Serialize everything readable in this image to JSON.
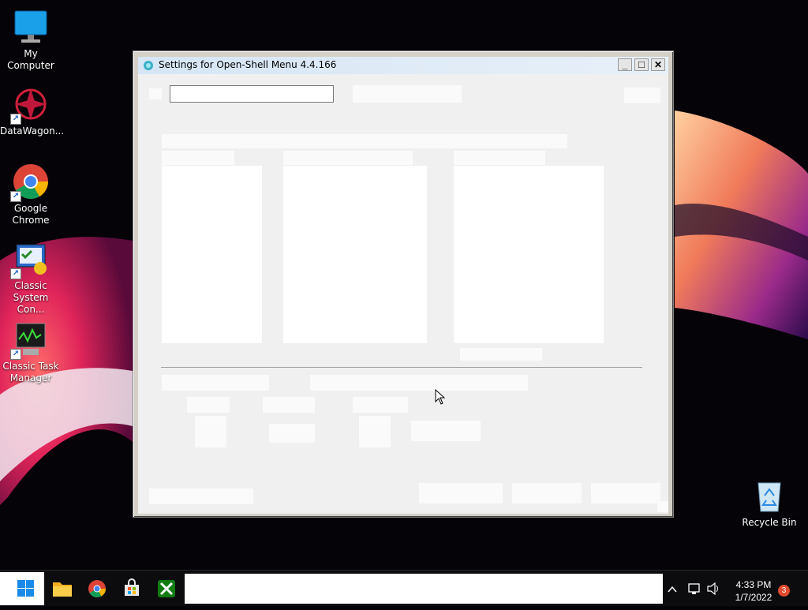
{
  "desktop": {
    "icons": [
      {
        "label": "My Computer",
        "icon": "monitor-icon"
      },
      {
        "label": "DataWagon...",
        "icon": "datawagon-icon"
      },
      {
        "label": "Google Chrome",
        "icon": "chrome-icon"
      },
      {
        "label": "Classic System Con...",
        "icon": "control-panel-icon"
      },
      {
        "label": "Classic Task Manager",
        "icon": "task-manager-icon"
      },
      {
        "label": "Recycle Bin",
        "icon": "recycle-bin-icon"
      }
    ]
  },
  "window": {
    "title": "Settings for Open-Shell Menu 4.4.166",
    "search_value": "",
    "controls": {
      "minimize": "_",
      "maximize": "□",
      "close": "✕"
    }
  },
  "taskbar": {
    "pinned": [
      "start-icon",
      "file-explorer-icon",
      "chrome-icon",
      "store-icon",
      "xbox-icon"
    ],
    "time": "4:33 PM",
    "date": "1/7/2022",
    "notification_count": "3"
  },
  "colors": {
    "titlebar": "#d6e6f5",
    "client": "#f0f0f0",
    "taskbar": "#0c0c0f",
    "badge": "#e04b2d"
  }
}
